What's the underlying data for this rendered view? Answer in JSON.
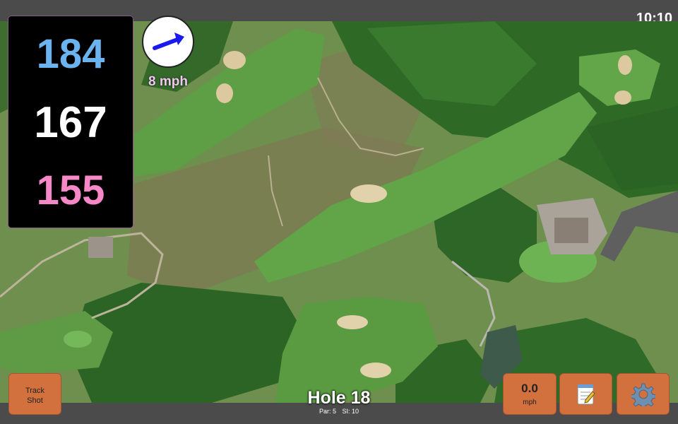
{
  "status_bar": {
    "time": "10:10"
  },
  "distances": {
    "back": "184",
    "middle": "167",
    "front": "155"
  },
  "wind": {
    "speed_label": "8 mph",
    "arrow_icon": "arrow-right-icon"
  },
  "hole": {
    "title": "Hole 18",
    "par": "Par: 5",
    "si": "SI: 10"
  },
  "buttons": {
    "track_shot_line1": "Track",
    "track_shot_line2": "Shot",
    "wind_value": "0.0",
    "wind_unit": "mph",
    "notes_icon": "notepad-icon",
    "settings_icon": "gear-icon"
  },
  "colors": {
    "back": "#6bb3ee",
    "middle": "#ffffff",
    "front": "#f788c8",
    "button": "#d2703e",
    "bar": "#4b4b4b"
  }
}
